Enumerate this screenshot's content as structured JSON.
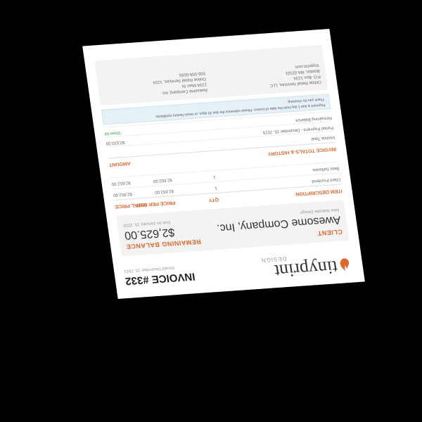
{
  "header": {
    "logo_text": "tinyprint",
    "logo_sub": "DESIGN",
    "title": "INVOICE #332",
    "date": "Issued December 15, 2015"
  },
  "client": {
    "label": "CLIENT",
    "name": "Awesome Company, Inc.",
    "sub": "New Website Design"
  },
  "balance": {
    "label": "REMAINING BALANCE",
    "amount": "$2,625.00",
    "due": "Due on January 15, 2016"
  },
  "items": {
    "headers": [
      "ITEM DESCRIPTION",
      "QTY",
      "PRICE PER UNIT",
      "TOTAL PRICE"
    ],
    "rows": [
      [
        "Client Frontend",
        "1",
        "$2,652.00",
        "$2,652.00"
      ],
      [
        "Beta Software",
        "1",
        "$2,652.00",
        "$2,652.00"
      ]
    ]
  },
  "history": {
    "heading": "INVOICE TOTALS & HISTORY",
    "amount_label": "AMOUNT",
    "rows": [
      [
        "Invoice Total",
        ""
      ],
      [
        "Partial Payment - December 15, 2015",
        "$2,520.00"
      ],
      [
        "Remaining Balance",
        "$2,520.00"
      ]
    ],
    "paid_label": "Show All",
    "due": "USD $2,652.00"
  },
  "notice": {
    "text": "Payment is due 1 day from the date of invoice. Please reference the due 30 days, or return factory conditions.",
    "sub": "Thank you for choosing"
  },
  "addresses": {
    "left": [
      "Online Retail Services, LLC",
      "P.O. Box 1234",
      "Boston, MA 02101",
      "tinyprint.com"
    ],
    "right": [
      "Awesome Company, Inc.",
      "1234 Main St",
      "Online Retail Services, 1234",
      "555-555-5555"
    ]
  }
}
